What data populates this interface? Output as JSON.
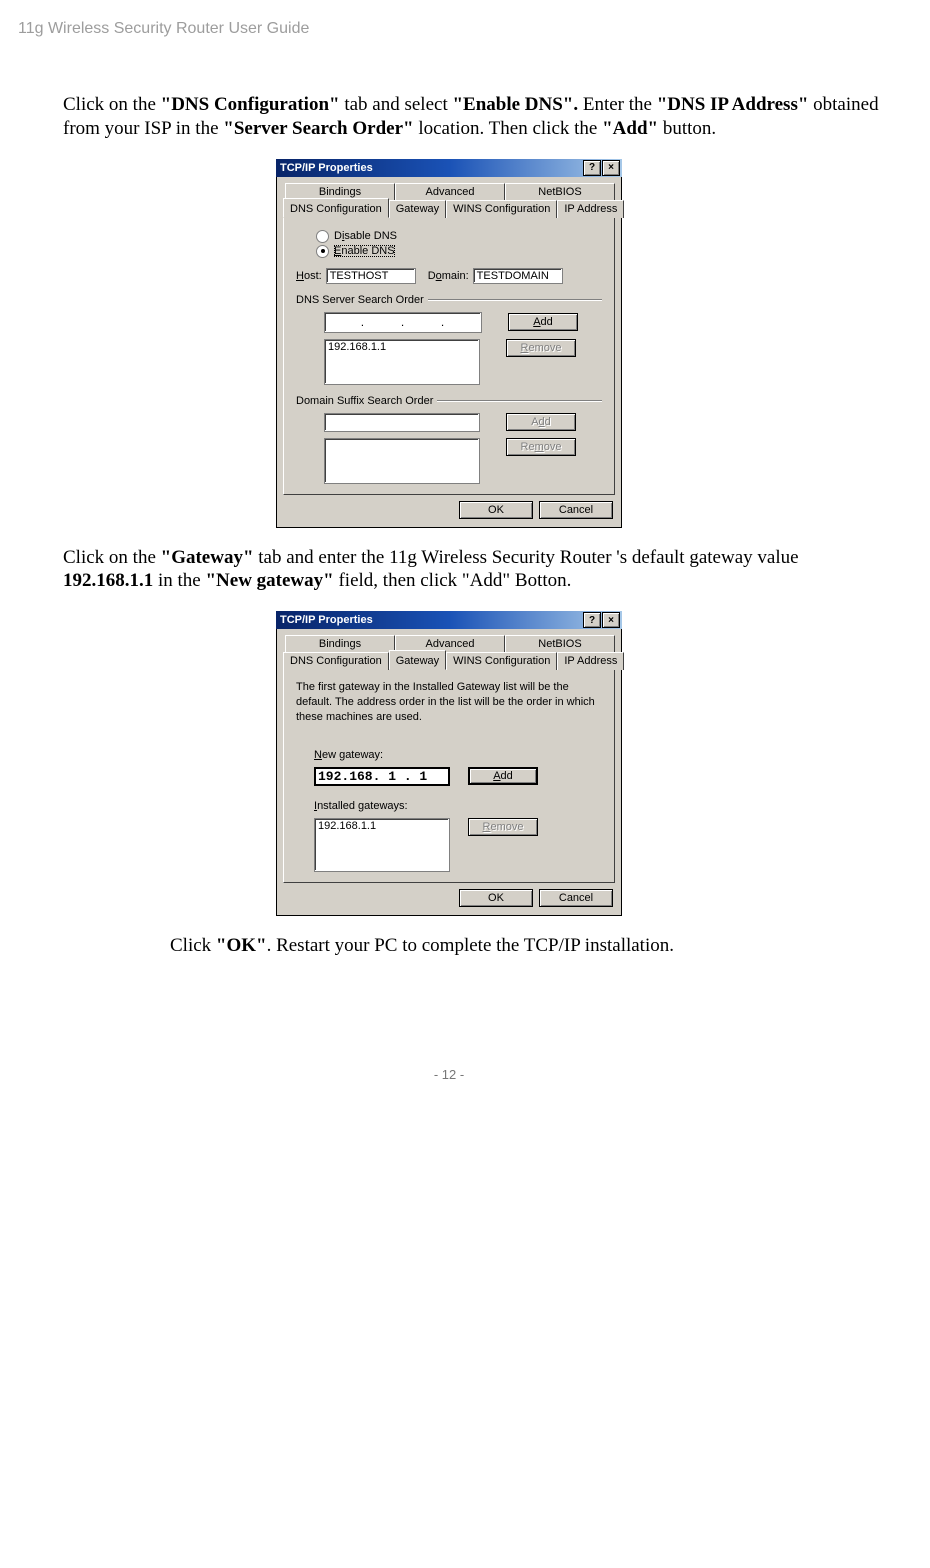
{
  "header": "11g Wireless Security Router User Guide",
  "footer": "- 12 -",
  "para1": {
    "s1": "Click on the ",
    "b1": "\"DNS Configuration\"",
    "s2": " tab and select ",
    "b2": "\"Enable DNS\".",
    "s3": " Enter the ",
    "b3": "\"DNS IP Address\"",
    "s4": " obtained from your ISP in the ",
    "b4": "\"Server Search Order\"",
    "s5": " location. Then click the ",
    "b5": "\"Add\"",
    "s6": " button."
  },
  "para2": {
    "s1": "Click on the ",
    "b1": "\"Gateway\"",
    "s2": " tab and enter the 11g Wireless Security Router 's default gateway value ",
    "b2": "192.168.1.1",
    "s3": " in the ",
    "b3": "\"New gateway\"",
    "s4": " field, then click \"Add\" Botton."
  },
  "para3": {
    "s1": "Click ",
    "b1": "\"OK\"",
    "s2": ". Restart your PC to complete the TCP/IP installation."
  },
  "dlg1": {
    "title": "TCP/IP Properties",
    "help": "?",
    "close": "×",
    "tabs_back": [
      "Bindings",
      "Advanced",
      "NetBIOS"
    ],
    "tabs_front": [
      "DNS Configuration",
      "Gateway",
      "WINS Configuration",
      "IP Address"
    ],
    "radio_disable": "Disable DNS",
    "radio_enable": "Enable DNS",
    "host_label": "Host:",
    "host_value": "TESTHOST",
    "domain_label": "Domain:",
    "domain_value": "TESTDOMAIN",
    "dns_order_label": "DNS Server Search Order",
    "ip_dots": ". . .",
    "add": "Add",
    "remove": "Remove",
    "dns_list": "192.168.1.1",
    "suffix_label": "Domain Suffix Search Order",
    "ok": "OK",
    "cancel": "Cancel"
  },
  "dlg2": {
    "title": "TCP/IP Properties",
    "help": "?",
    "close": "×",
    "tabs_back": [
      "Bindings",
      "Advanced",
      "NetBIOS"
    ],
    "tabs_front": [
      "DNS Configuration",
      "Gateway",
      "WINS Configuration",
      "IP Address"
    ],
    "explain": "The first gateway in the Installed Gateway list will be the default. The address order in the list will be the order in which these machines are used.",
    "new_gw_label": "New gateway:",
    "new_gw_value": "192.168. 1 . 1",
    "add": "Add",
    "installed_label": "Installed gateways:",
    "installed_value": "192.168.1.1",
    "remove": "Remove",
    "ok": "OK",
    "cancel": "Cancel"
  }
}
